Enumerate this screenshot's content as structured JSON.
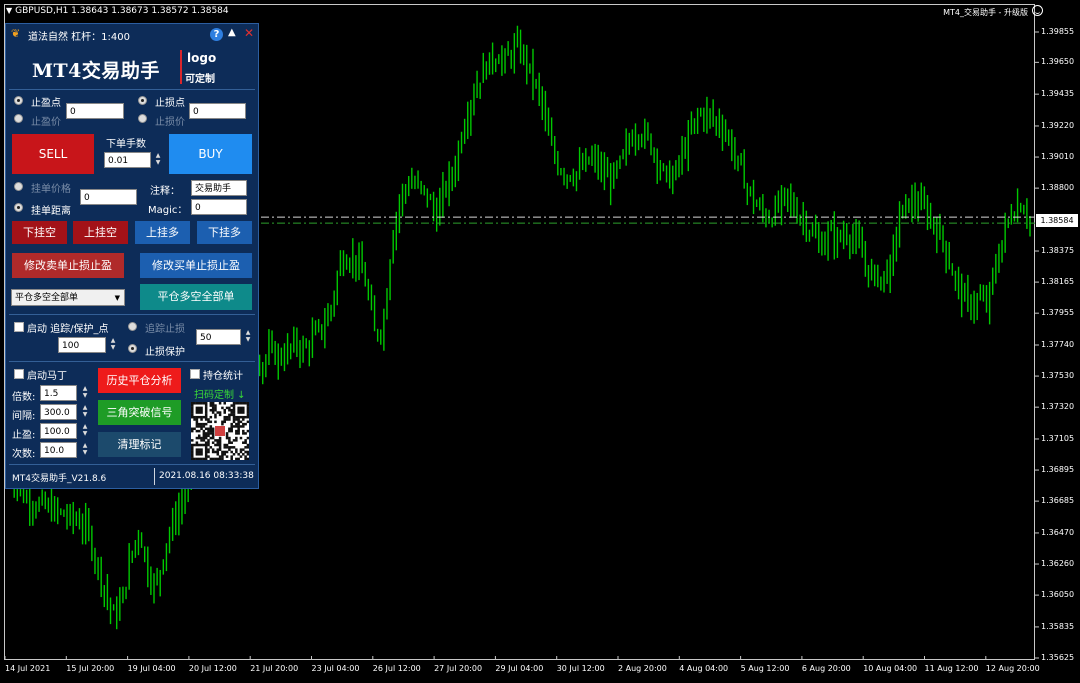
{
  "chart": {
    "header": "GBPUSD,H1  1.38643 1.38673 1.38572 1.38584",
    "ea_label": "MT4_交易助手 - 升级版",
    "current_price": "1.38584",
    "colors": {
      "background": "#000000",
      "candle": "#00c800",
      "axis_text": "#ffffff"
    }
  },
  "chart_data": {
    "type": "bar",
    "title": "GBPUSD,H1",
    "y_ticks": [
      "1.39855",
      "1.39650",
      "1.39435",
      "1.39220",
      "1.39010",
      "1.38800",
      "1.38375",
      "1.38165",
      "1.37955",
      "1.37740",
      "1.37530",
      "1.37320",
      "1.37105",
      "1.36895",
      "1.36685",
      "1.36470",
      "1.36260",
      "1.36050",
      "1.35835",
      "1.35625"
    ],
    "x_ticks": [
      "14 Jul 2021",
      "15 Jul 20:00",
      "19 Jul 04:00",
      "20 Jul 12:00",
      "21 Jul 20:00",
      "23 Jul 04:00",
      "26 Jul 12:00",
      "27 Jul 20:00",
      "29 Jul 04:00",
      "30 Jul 12:00",
      "2 Aug 20:00",
      "4 Aug 04:00",
      "5 Aug 12:00",
      "6 Aug 20:00",
      "10 Aug 04:00",
      "11 Aug 12:00",
      "12 Aug 20:00"
    ],
    "ylim": [
      1.35625,
      1.39855
    ],
    "last_price": 1.38584,
    "close_path": [
      [
        0,
        1.369
      ],
      [
        2,
        1.367
      ],
      [
        4,
        1.3665
      ],
      [
        6,
        1.366
      ],
      [
        8,
        1.3655
      ],
      [
        9,
        1.365
      ],
      [
        10,
        1.363
      ],
      [
        11,
        1.361
      ],
      [
        12,
        1.359
      ],
      [
        13,
        1.36
      ],
      [
        14,
        1.363
      ],
      [
        15,
        1.365
      ],
      [
        16,
        1.362
      ],
      [
        17,
        1.361
      ],
      [
        18,
        1.364
      ],
      [
        19,
        1.3655
      ],
      [
        20,
        1.367
      ],
      [
        21,
        1.369
      ],
      [
        22,
        1.371
      ],
      [
        23,
        1.373
      ],
      [
        24,
        1.375
      ],
      [
        25,
        1.3765
      ],
      [
        26,
        1.377
      ],
      [
        27,
        1.3765
      ],
      [
        28,
        1.377
      ],
      [
        29,
        1.376
      ],
      [
        30,
        1.377
      ],
      [
        31,
        1.3765
      ],
      [
        32,
        1.377
      ],
      [
        33,
        1.3775
      ],
      [
        34,
        1.377
      ],
      [
        35,
        1.378
      ],
      [
        36,
        1.3785
      ],
      [
        37,
        1.38
      ],
      [
        38,
        1.383
      ],
      [
        39,
        1.3835
      ],
      [
        40,
        1.383
      ],
      [
        41,
        1.3815
      ],
      [
        42,
        1.378
      ],
      [
        43,
        1.379
      ],
      [
        44,
        1.385
      ],
      [
        45,
        1.3875
      ],
      [
        46,
        1.3885
      ],
      [
        47,
        1.388
      ],
      [
        48,
        1.3875
      ],
      [
        49,
        1.386
      ],
      [
        50,
        1.388
      ],
      [
        51,
        1.389
      ],
      [
        52,
        1.392
      ],
      [
        53,
        1.394
      ],
      [
        54,
        1.3955
      ],
      [
        55,
        1.3965
      ],
      [
        56,
        1.397
      ],
      [
        57,
        1.3965
      ],
      [
        58,
        1.3975
      ],
      [
        59,
        1.397
      ],
      [
        60,
        1.3955
      ],
      [
        61,
        1.394
      ],
      [
        62,
        1.391
      ],
      [
        63,
        1.3895
      ],
      [
        64,
        1.389
      ],
      [
        65,
        1.389
      ],
      [
        66,
        1.3895
      ],
      [
        67,
        1.39
      ],
      [
        68,
        1.389
      ],
      [
        69,
        1.3885
      ],
      [
        70,
        1.3895
      ],
      [
        71,
        1.391
      ],
      [
        72,
        1.392
      ],
      [
        73,
        1.3915
      ],
      [
        74,
        1.3905
      ],
      [
        75,
        1.389
      ],
      [
        76,
        1.3885
      ],
      [
        77,
        1.39
      ],
      [
        78,
        1.3915
      ],
      [
        79,
        1.393
      ],
      [
        80,
        1.393
      ],
      [
        81,
        1.3925
      ],
      [
        82,
        1.392
      ],
      [
        83,
        1.3905
      ],
      [
        84,
        1.389
      ],
      [
        85,
        1.3875
      ],
      [
        86,
        1.3865
      ],
      [
        87,
        1.386
      ],
      [
        88,
        1.3865
      ],
      [
        89,
        1.3875
      ],
      [
        90,
        1.3865
      ],
      [
        91,
        1.386
      ],
      [
        92,
        1.385
      ],
      [
        93,
        1.384
      ],
      [
        94,
        1.385
      ],
      [
        95,
        1.3845
      ],
      [
        96,
        1.385
      ],
      [
        97,
        1.3845
      ],
      [
        98,
        1.383
      ],
      [
        99,
        1.382
      ],
      [
        100,
        1.382
      ],
      [
        101,
        1.3825
      ],
      [
        102,
        1.386
      ],
      [
        103,
        1.387
      ],
      [
        104,
        1.387
      ],
      [
        105,
        1.3865
      ],
      [
        106,
        1.3855
      ],
      [
        107,
        1.3845
      ],
      [
        108,
        1.3825
      ],
      [
        109,
        1.381
      ],
      [
        110,
        1.38
      ],
      [
        111,
        1.3805
      ],
      [
        112,
        1.38
      ],
      [
        113,
        1.3825
      ],
      [
        114,
        1.385
      ],
      [
        115,
        1.3865
      ],
      [
        116,
        1.387
      ],
      [
        117,
        1.38584
      ]
    ]
  },
  "panel": {
    "title": "道法自然  杠杆：1:400",
    "logo_text": "MT4交易助手",
    "logo_word": "logo",
    "logo_custom": "可定制",
    "tp_point_label": "止盈点",
    "tp_price_label": "止盈价",
    "tp_value": "0",
    "sl_point_label": "止损点",
    "sl_price_label": "止损价",
    "sl_value": "0",
    "sell_label": "SELL",
    "buy_label": "BUY",
    "lots_label": "下单手数",
    "lots_value": "0.01",
    "pending_price_label": "挂单价格",
    "pending_distance_label": "挂单距离",
    "pending_value": "0",
    "comment_label": "注释：",
    "comment_value": "交易助手",
    "magic_label": "Magic：",
    "magic_value": "0",
    "btn_sell_stop": "下挂空",
    "btn_sell_limit": "上挂空",
    "btn_buy_stop": "上挂多",
    "btn_buy_limit": "下挂多",
    "btn_modify_sell": "修改卖单止损止盈",
    "btn_modify_buy": "修改买单止损止盈",
    "close_select": "平仓多空全部单",
    "btn_close_all": "平仓多空全部单",
    "trailing_label": "启动 追踪/保护_点",
    "trailing_stop_label": "追踪止损",
    "sl_protect_label": "止损保护",
    "trailing_value": "100",
    "protect_value": "50",
    "martin_label": "启动马丁",
    "multiplier_label": "倍数:",
    "multiplier_value": "1.5",
    "interval_label": "间隔:",
    "interval_value": "300.0",
    "tp_label": "止盈:",
    "tp_martin_value": "100.0",
    "count_label": "次数:",
    "count_value": "10.0",
    "btn_history": "历史平仓分析",
    "btn_triangle": "三角突破信号",
    "btn_clear": "清理标记",
    "position_stats_label": "持仓统计",
    "scan_label": "扫码定制 ↓",
    "footer_version": "MT4交易助手_V21.8.6",
    "footer_time": "2021.08.16 08:33:38",
    "colors": {
      "panel": "#0d2c58",
      "sell": "#c8151a",
      "buy": "#1f8cf0",
      "red_btn": "#a31218",
      "blue_btn": "#1c5fb0",
      "teal": "#0e8a8a",
      "history": "#ee1b1b",
      "triangle": "#1e9c26",
      "clear": "#1c4a6c"
    }
  }
}
